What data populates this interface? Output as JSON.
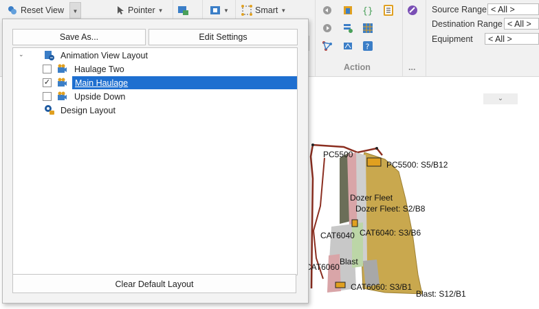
{
  "toolbar": {
    "reset_view_label": "Reset View",
    "pointer_label": "Pointer",
    "smart_label": "Smart",
    "action_group_label": "Action",
    "more_group_label": "..."
  },
  "filters": {
    "source_range_label": "Source Range",
    "source_range_value": "< All >",
    "destination_range_label": "Destination Range",
    "destination_range_value": "< All >",
    "equipment_label": "Equipment",
    "equipment_value": "< All >"
  },
  "layout_popup": {
    "save_as_label": "Save As...",
    "edit_settings_label": "Edit Settings",
    "clear_default_label": "Clear Default Layout",
    "tree": {
      "root_label": "Animation View Layout",
      "children": [
        {
          "label": "Haulage Two",
          "checked": false,
          "selected": false
        },
        {
          "label": "Main Haulage",
          "checked": true,
          "selected": true
        },
        {
          "label": "Upside Down",
          "checked": false,
          "selected": false
        }
      ],
      "design_label": "Design Layout"
    }
  },
  "map_labels": {
    "pc5500": "PC5500",
    "pc5500_loc": "PC5500: S5/B12",
    "dozer_fleet": "Dozer Fleet",
    "dozer_fleet_loc": "Dozer Fleet: S2/B8",
    "cat6040": "CAT6040",
    "cat6040_loc": "CAT6040: S3/B6",
    "blast": "Blast",
    "cat6060": "CAT6060",
    "cat6060_loc": "CAT6060: S3/B1",
    "blast_loc": "Blast: S12/B1"
  },
  "icons": {
    "reset_view": "reset-view-icon",
    "pointer": "pointer-cursor-icon",
    "smart": "smart-select-icon",
    "camera": "camera-icon",
    "layout": "layout-icon",
    "design": "design-layout-icon"
  },
  "colors": {
    "selection": "#1e6fd0",
    "ribbon_bg": "#f1f1f1",
    "pit_tan": "#c9a84e"
  }
}
